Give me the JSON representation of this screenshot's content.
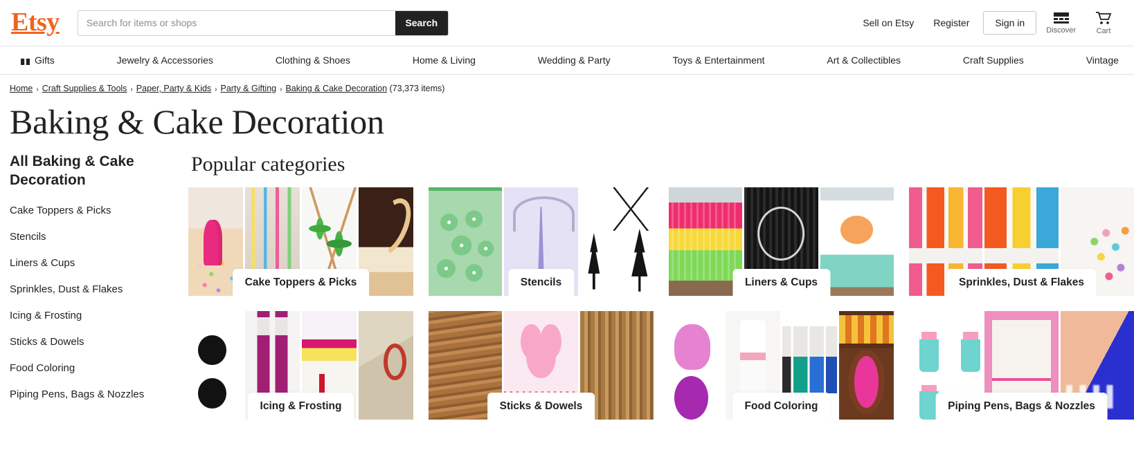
{
  "header": {
    "logo_text": "Etsy",
    "search": {
      "placeholder": "Search for items or shops",
      "value": "",
      "button_label": "Search"
    },
    "sell_label": "Sell on Etsy",
    "register_label": "Register",
    "signin_label": "Sign in",
    "discover_label": "Discover",
    "cart_label": "Cart",
    "brand_color": "#F1641E"
  },
  "nav": {
    "items": [
      {
        "label": "Gifts",
        "icon": "gift-icon"
      },
      {
        "label": "Jewelry & Accessories",
        "icon": ""
      },
      {
        "label": "Clothing & Shoes",
        "icon": ""
      },
      {
        "label": "Home & Living",
        "icon": ""
      },
      {
        "label": "Wedding & Party",
        "icon": ""
      },
      {
        "label": "Toys & Entertainment",
        "icon": ""
      },
      {
        "label": "Art & Collectibles",
        "icon": ""
      },
      {
        "label": "Craft Supplies",
        "icon": ""
      },
      {
        "label": "Vintage",
        "icon": ""
      }
    ]
  },
  "breadcrumb": {
    "items": [
      "Home",
      "Craft Supplies & Tools",
      "Paper, Party & Kids",
      "Party & Gifting",
      "Baking & Cake Decoration"
    ],
    "separator": "›",
    "item_count": "(73,373 items)"
  },
  "page_title": "Baking & Cake Decoration",
  "sidebar": {
    "title": "All Baking & Cake Decoration",
    "items": [
      {
        "label": "Cake Toppers & Picks"
      },
      {
        "label": "Stencils"
      },
      {
        "label": "Liners & Cups"
      },
      {
        "label": "Sprinkles, Dust & Flakes"
      },
      {
        "label": "Icing & Frosting"
      },
      {
        "label": "Sticks & Dowels"
      },
      {
        "label": "Food Coloring"
      },
      {
        "label": "Piping Pens, Bags & Nozzles"
      }
    ]
  },
  "main": {
    "section_title": "Popular categories",
    "cards": [
      {
        "label": "Cake Toppers & Picks",
        "tiles": [
          "art-sprinkle-cake",
          "art-candles",
          "art-palms",
          "art-chocolate"
        ]
      },
      {
        "label": "Stencils",
        "tiles": [
          "art-green-stencil",
          "art-eiffel",
          "art-forest"
        ]
      },
      {
        "label": "Liners & Cups",
        "tiles": [
          "art-liner-rainbow",
          "art-black-liner",
          "art-daisy-liner"
        ]
      },
      {
        "label": "Sprinkles, Dust & Flakes",
        "tiles": [
          "art-jars-a",
          "art-jars-b",
          "art-sprinkle-jar"
        ]
      },
      {
        "label": "Icing & Frosting",
        "tiles": [
          "art-icing-black",
          "art-gel-tube",
          "art-flavor-pack",
          "art-vintage-tools"
        ]
      },
      {
        "label": "Sticks & Dowels",
        "tiles": [
          "art-cinnamon",
          "art-bunny",
          "art-dowels"
        ]
      },
      {
        "label": "Food Coloring",
        "tiles": [
          "art-gel-pink",
          "art-squeeze",
          "art-colorbottles",
          "art-choco-label"
        ]
      },
      {
        "label": "Piping Pens, Bags & Nozzles",
        "tiles": [
          "art-nozzle-chart",
          "art-pink-paper",
          "art-bag"
        ]
      }
    ]
  }
}
